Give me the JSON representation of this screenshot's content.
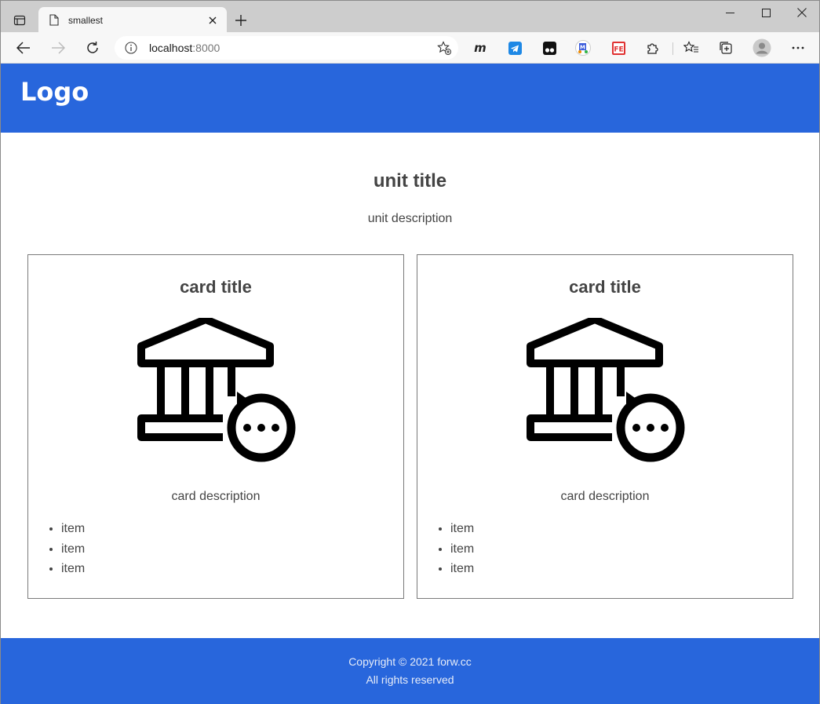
{
  "browser": {
    "tab_title": "smallest",
    "url_host": "localhost",
    "url_port": ":8000"
  },
  "header": {
    "logo": "Logo"
  },
  "unit": {
    "title": "unit title",
    "description": "unit description"
  },
  "cards": [
    {
      "title": "card title",
      "icon": "bank-chat-icon",
      "description": "card description",
      "items": [
        "item",
        "item",
        "item"
      ]
    },
    {
      "title": "card title",
      "icon": "bank-chat-icon",
      "description": "card description",
      "items": [
        "item",
        "item",
        "item"
      ]
    }
  ],
  "footer": {
    "copyright": "Copyright © 2021 forw.cc",
    "rights": "All rights reserved"
  },
  "colors": {
    "brand": "#2866dc",
    "text": "#444444"
  }
}
